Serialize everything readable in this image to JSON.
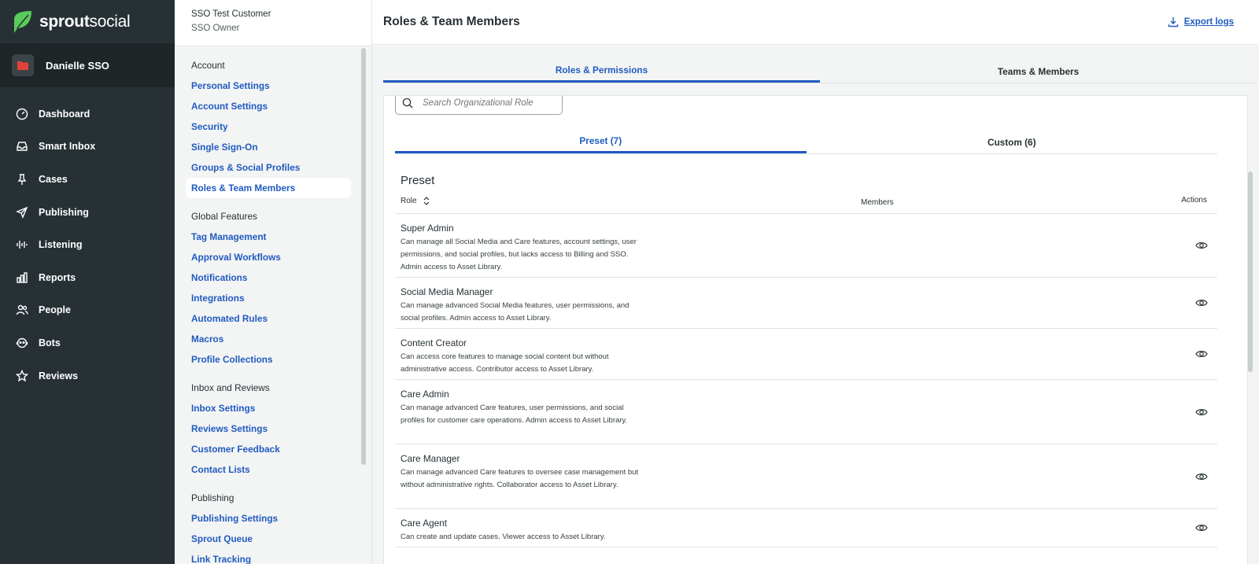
{
  "brand": {
    "name_bold": "sprout",
    "name_light": "social",
    "logo_color": "#59cb59"
  },
  "account": {
    "name": "Danielle SSO",
    "avatar_color": "#e5413a"
  },
  "nav": [
    {
      "label": "Dashboard",
      "icon": "gauge-icon"
    },
    {
      "label": "Smart Inbox",
      "icon": "inbox-icon"
    },
    {
      "label": "Cases",
      "icon": "pin-icon"
    },
    {
      "label": "Publishing",
      "icon": "paper-plane-icon"
    },
    {
      "label": "Listening",
      "icon": "waveform-icon"
    },
    {
      "label": "Reports",
      "icon": "bar-chart-icon"
    },
    {
      "label": "People",
      "icon": "people-icon"
    },
    {
      "label": "Bots",
      "icon": "bot-icon"
    },
    {
      "label": "Reviews",
      "icon": "star-icon"
    }
  ],
  "customer": {
    "name": "SSO Test Customer",
    "role": "SSO Owner"
  },
  "settings_nav": {
    "account_header": "Account",
    "account_links": [
      "Personal Settings",
      "Account Settings",
      "Security",
      "Single Sign-On",
      "Groups & Social Profiles",
      "Roles & Team Members"
    ],
    "global_header": "Global Features",
    "global_links": [
      "Tag Management",
      "Approval Workflows",
      "Notifications",
      "Integrations",
      "Automated Rules",
      "Macros",
      "Profile Collections"
    ],
    "inbox_header": "Inbox and Reviews",
    "inbox_links": [
      "Inbox Settings",
      "Reviews Settings",
      "Customer Feedback",
      "Contact Lists"
    ],
    "publishing_header": "Publishing",
    "publishing_links": [
      "Publishing Settings",
      "Sprout Queue",
      "Link Tracking"
    ]
  },
  "main": {
    "title": "Roles & Team Members",
    "export_label": "Export logs",
    "tabs": [
      "Roles & Permissions",
      "Teams & Members"
    ],
    "search_placeholder": "Search Organizational Role",
    "subtabs": [
      "Preset (7)",
      "Custom (6)"
    ],
    "section_title": "Preset",
    "columns": {
      "role": "Role",
      "members": "Members",
      "actions": "Actions"
    },
    "roles": [
      {
        "name": "Super Admin",
        "desc": "Can manage all Social Media and Care features, account settings, user permissions, and social profiles, but lacks access to Billing and SSO. Admin access to Asset Library."
      },
      {
        "name": "Social Media Manager",
        "desc": "Can manage advanced Social Media features, user permissions, and social profiles. Admin access to Asset Library."
      },
      {
        "name": "Content Creator",
        "desc": "Can access core features to manage social content but without administrative access. Contributor access to Asset Library."
      },
      {
        "name": "Care Admin",
        "desc": "Can manage advanced Care features, user permissions, and social profiles for customer care operations. Admin access to Asset Library."
      },
      {
        "name": "Care Manager",
        "desc": "Can manage advanced Care features to oversee case management but without administrative rights. Collaborator access to Asset Library."
      },
      {
        "name": "Care Agent",
        "desc": "Can create and update cases. Viewer access to Asset Library."
      }
    ]
  }
}
